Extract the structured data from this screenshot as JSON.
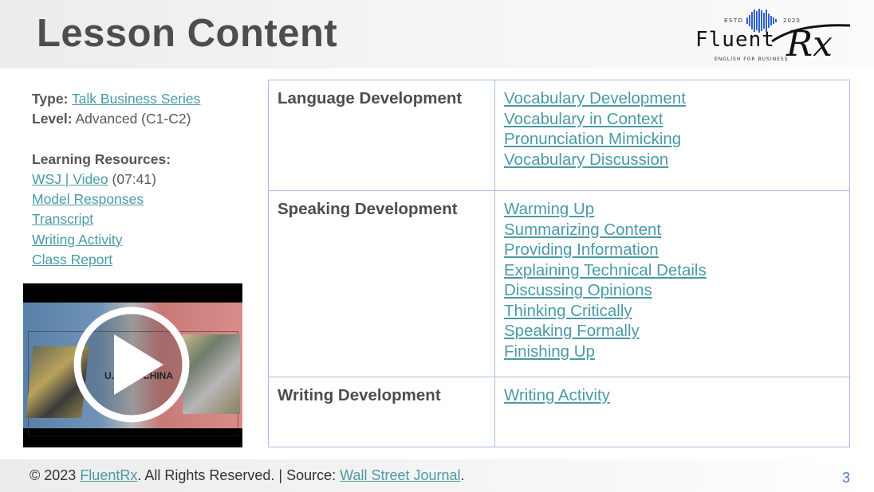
{
  "header": {
    "title": "Lesson Content"
  },
  "logo": {
    "estd": "ESTD",
    "year": "2020",
    "brand": "Fluent",
    "brand_script": "Rx",
    "tagline": "ENGLISH FOR BUSINESS",
    "color": "#2f62c6"
  },
  "info": {
    "type_label": "Type:",
    "type_value": "Talk Business Series",
    "level_label": "Level:",
    "level_value": "Advanced (C1-C2)",
    "resources_label": "Learning Resources:",
    "video_link": "WSJ | Video",
    "video_duration": "(07:41)",
    "resources": [
      "Model Responses",
      "Transcript",
      "Writing Activity",
      "Class Report"
    ]
  },
  "video": {
    "left_text": "U.S.",
    "right_text": "CHINA",
    "icon": "play-icon"
  },
  "table": {
    "rows": [
      {
        "heading": "Language Development",
        "links": [
          "Vocabulary Development",
          "Vocabulary in Context",
          "Pronunciation Mimicking",
          "Vocabulary Discussion"
        ]
      },
      {
        "heading": "Speaking Development",
        "links": [
          "Warming Up",
          "Summarizing Content",
          "Providing Information",
          "Explaining Technical Details",
          "Discussing Opinions",
          "Thinking Critically",
          "Speaking Formally",
          "Finishing Up"
        ]
      },
      {
        "heading": "Writing Development",
        "links": [
          "Writing Activity"
        ]
      }
    ]
  },
  "footer": {
    "copy_prefix": "© 2023 ",
    "brand_link": "FluentRx",
    "copy_middle": ". All Rights Reserved. | Source: ",
    "source_link": "Wall Street Journal",
    "copy_suffix": ".",
    "page_number": "3"
  },
  "colors": {
    "link": "#4a9aa5",
    "table_border": "#a9bfe0",
    "page_number": "#4a77c4"
  }
}
